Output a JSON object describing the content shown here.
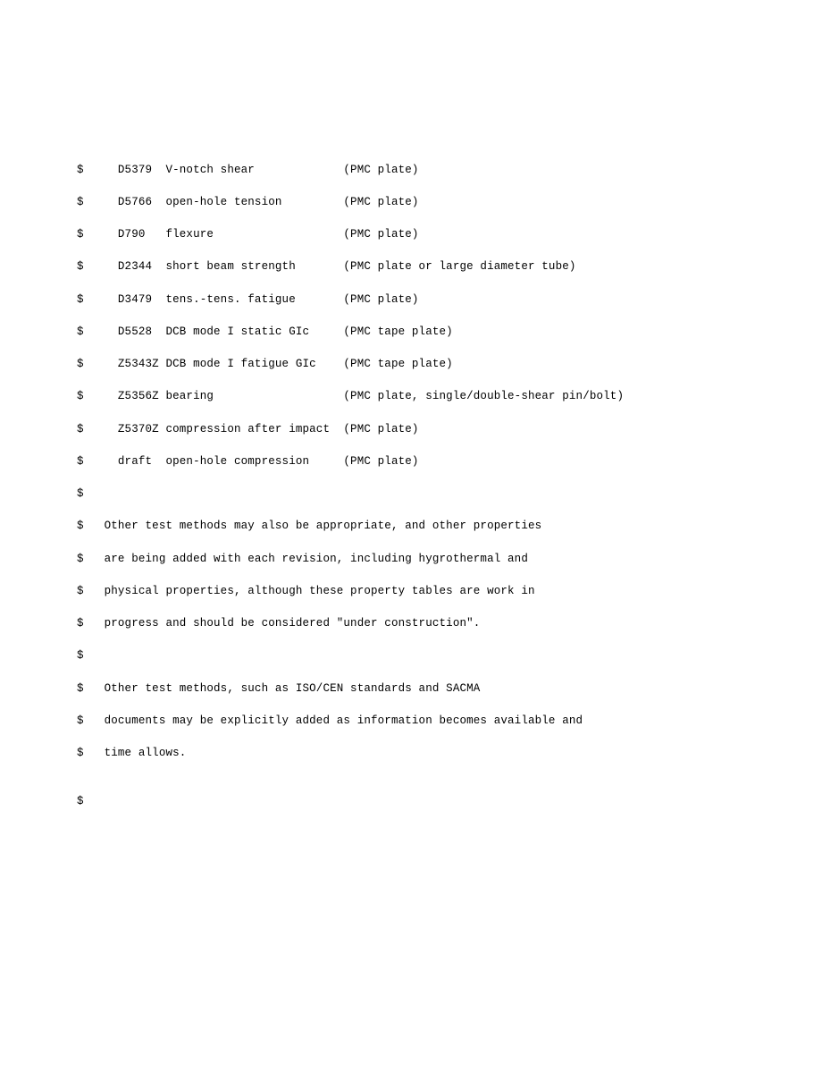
{
  "lines": [
    "$     D5379  V-notch shear             (PMC plate)",
    "$     D5766  open-hole tension         (PMC plate)",
    "$     D790   flexure                   (PMC plate)",
    "$     D2344  short beam strength       (PMC plate or large diameter tube)",
    "$     D3479  tens.-tens. fatigue       (PMC plate)",
    "$     D5528  DCB mode I static GIc     (PMC tape plate)",
    "$     Z5343Z DCB mode I fatigue GIc    (PMC tape plate)",
    "$     Z5356Z bearing                   (PMC plate, single/double-shear pin/bolt)",
    "$     Z5370Z compression after impact  (PMC plate)",
    "$     draft  open-hole compression     (PMC plate)",
    "$",
    "$   Other test methods may also be appropriate, and other properties",
    "$   are being added with each revision, including hygrothermal and",
    "$   physical properties, although these property tables are work in",
    "$   progress and should be considered \"under construction\".",
    "$",
    "$   Other test methods, such as ISO/CEN standards and SACMA",
    "$   documents may be explicitly added as information becomes available and",
    "$   time allows.",
    "",
    "$"
  ]
}
